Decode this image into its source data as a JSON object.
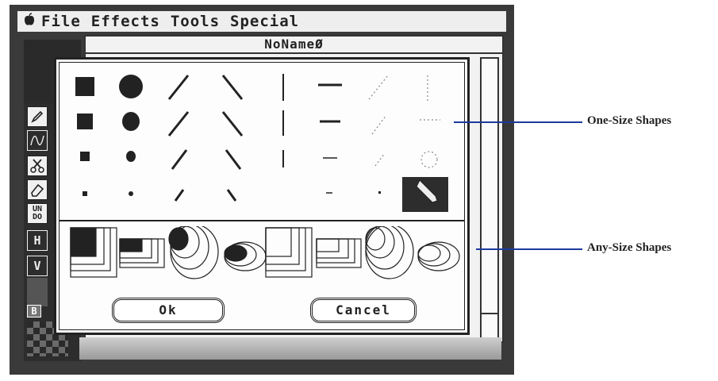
{
  "menubar": {
    "apple_icon": "apple-icon",
    "menus": [
      "File",
      "Effects",
      "Tools",
      "Special"
    ]
  },
  "window": {
    "title": "NoNameØ"
  },
  "palette": {
    "tools": [
      {
        "name": "pencil-tool",
        "glyph": "✎"
      },
      {
        "name": "curve-tool",
        "glyph": "∿"
      },
      {
        "name": "scissors-tool",
        "glyph": "✂"
      },
      {
        "name": "eraser-tool",
        "glyph": "⌫"
      },
      {
        "name": "undo-tool",
        "label": "UNDO"
      },
      {
        "name": "h-tool",
        "label": "H"
      },
      {
        "name": "v-tool",
        "label": "V"
      },
      {
        "name": "b-tool",
        "label": "B"
      }
    ]
  },
  "dialog": {
    "ok_label": "Ok",
    "cancel_label": "Cancel",
    "selected_shape": "pencil"
  },
  "callouts": {
    "one_size": "One-Size Shapes",
    "any_size": "Any-Size Shapes",
    "line_color": "#1b3a9c"
  }
}
